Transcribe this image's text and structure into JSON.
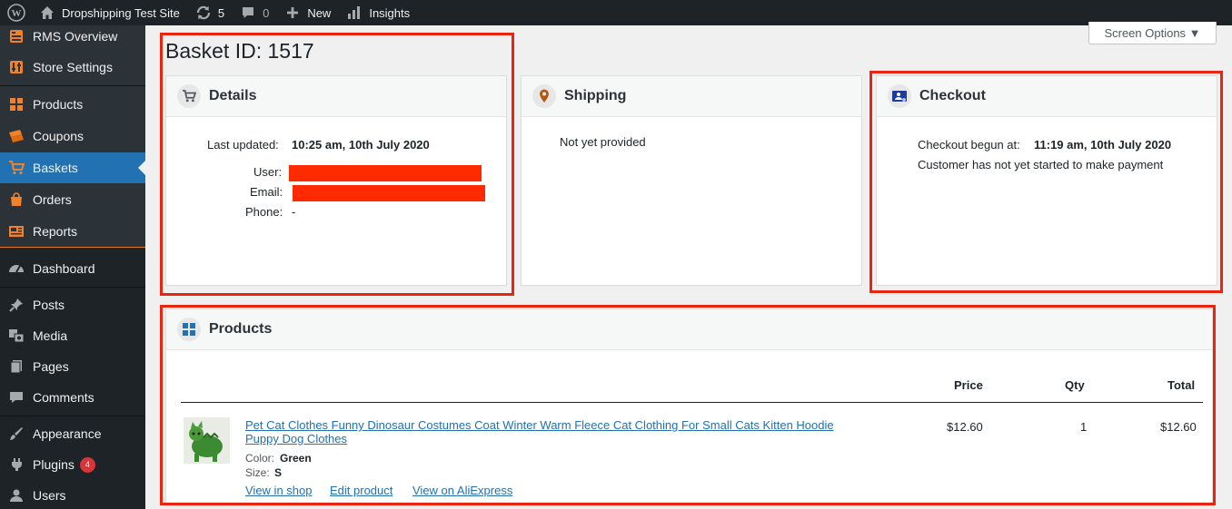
{
  "adminbar": {
    "site_name": "Dropshipping Test Site",
    "updates_count": "5",
    "comments_count": "0",
    "new_label": "New",
    "insights_label": "Insights"
  },
  "sidebar": {
    "items": [
      {
        "label": "RMS Overview",
        "icon": "rms-overview-icon"
      },
      {
        "label": "Store Settings",
        "icon": "store-settings-icon"
      },
      {
        "label": "Products",
        "icon": "products-grid-icon"
      },
      {
        "label": "Coupons",
        "icon": "coupons-icon"
      },
      {
        "label": "Baskets",
        "icon": "cart-icon",
        "active": true
      },
      {
        "label": "Orders",
        "icon": "bag-icon"
      },
      {
        "label": "Reports",
        "icon": "reports-icon"
      },
      {
        "label": "Dashboard",
        "icon": "dashboard-gauge-icon"
      },
      {
        "label": "Posts",
        "icon": "pin-icon"
      },
      {
        "label": "Media",
        "icon": "media-icon"
      },
      {
        "label": "Pages",
        "icon": "pages-icon"
      },
      {
        "label": "Comments",
        "icon": "comment-icon"
      },
      {
        "label": "Appearance",
        "icon": "brush-icon"
      },
      {
        "label": "Plugins",
        "icon": "plug-icon",
        "badge": "4"
      },
      {
        "label": "Users",
        "icon": "user-icon"
      }
    ]
  },
  "screen_options": "Screen Options ▼",
  "basket": {
    "title": "Basket ID: 1517",
    "details": {
      "heading": "Details",
      "last_updated_label": "Last updated:",
      "last_updated_value": "10:25 am, 10th July 2020",
      "user_label": "User:",
      "email_label": "Email:",
      "phone_label": "Phone:",
      "phone_value": "-"
    },
    "shipping": {
      "heading": "Shipping",
      "text": "Not yet provided"
    },
    "checkout": {
      "heading": "Checkout",
      "begun_label": "Checkout begun at:",
      "begun_value": "11:19 am, 10th July 2020",
      "status": "Customer has not yet started to make payment"
    },
    "products": {
      "heading": "Products",
      "columns": {
        "price": "Price",
        "qty": "Qty",
        "total": "Total"
      },
      "rows": [
        {
          "name_line1": "Pet Cat Clothes Funny Dinosaur Costumes Coat Winter Warm Fleece Cat Clothing For Small Cats Kitten Hoodie",
          "name_line2": "Puppy Dog Clothes",
          "color_label": "Color:",
          "color_value": "Green",
          "size_label": "Size:",
          "size_value": "S",
          "price": "$12.60",
          "qty": "1",
          "total": "$12.60",
          "links": [
            "View in shop",
            "Edit product",
            "View on AliExpress"
          ]
        }
      ]
    }
  },
  "colors": {
    "admin_dark": "#1d2327",
    "active_blue": "#2271b1",
    "highlight_red": "#e8260f",
    "redaction_red": "#ff2a00",
    "rms_orange": "#f0822a"
  }
}
